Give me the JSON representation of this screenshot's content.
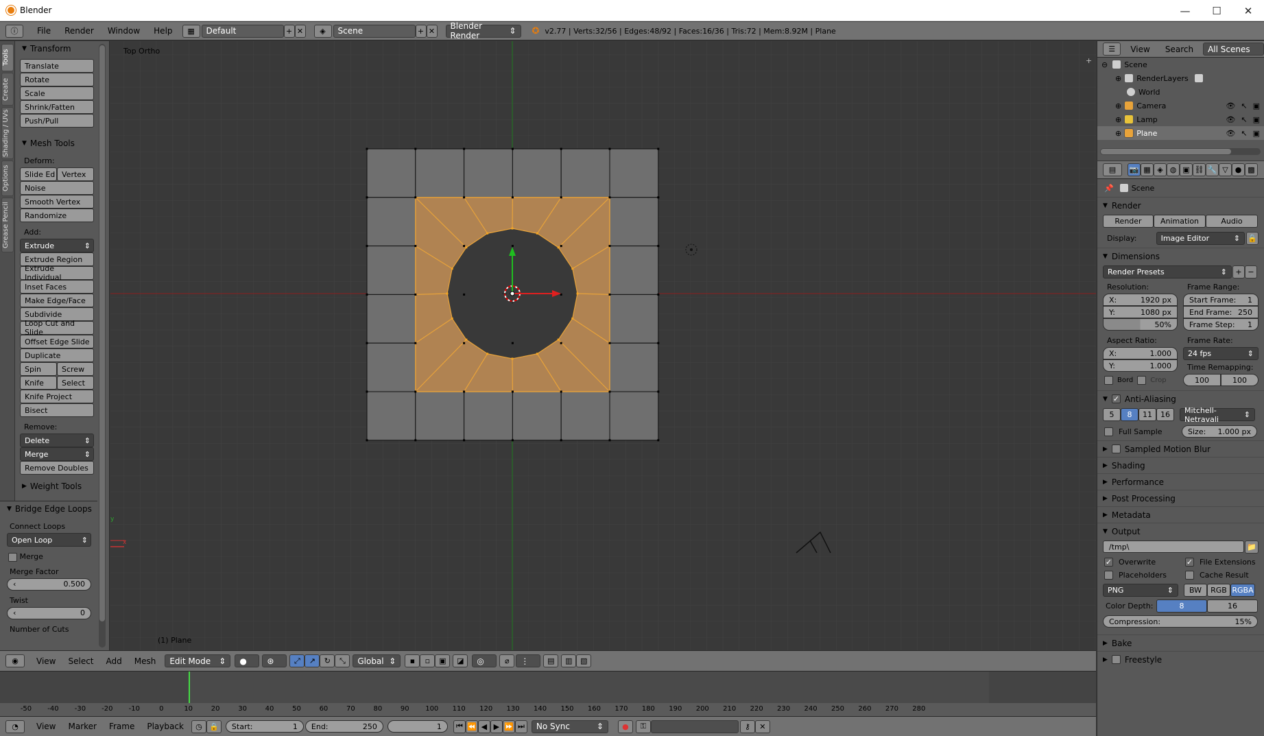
{
  "window": {
    "title": "Blender",
    "minimize": "—",
    "maximize": "☐",
    "close": "✕"
  },
  "info": {
    "menus": [
      "File",
      "Render",
      "Window",
      "Help"
    ],
    "layout": "Default",
    "scene": "Scene",
    "engine": "Blender Render",
    "stats": "v2.77 | Verts:32/56 | Edges:48/92 | Faces:16/36 | Tris:72 | Mem:8.92M | Plane"
  },
  "tabs": [
    "Tools",
    "Create",
    "Shading / UVs",
    "Options",
    "Grease Pencil"
  ],
  "tools": {
    "transform_title": "Transform",
    "transform": [
      "Translate",
      "Rotate",
      "Scale",
      "Shrink/Fatten",
      "Push/Pull"
    ],
    "mesh_title": "Mesh Tools",
    "deform_label": "Deform:",
    "deform_row": [
      "Slide Ed",
      "Vertex"
    ],
    "deform": [
      "Noise",
      "Smooth Vertex",
      "Randomize"
    ],
    "add_label": "Add:",
    "extrude": "Extrude",
    "add": [
      "Extrude Region",
      "Extrude Individual",
      "Inset Faces",
      "Make Edge/Face",
      "Subdivide",
      "Loop Cut and Slide",
      "Offset Edge Slide",
      "Duplicate"
    ],
    "spin_row": [
      "Spin",
      "Screw"
    ],
    "knife_row": [
      "Knife",
      "Select"
    ],
    "add2": [
      "Knife Project",
      "Bisect"
    ],
    "remove_label": "Remove:",
    "delete": "Delete",
    "merge": "Merge",
    "remove_doubles": "Remove Doubles",
    "weight_title": "Weight Tools"
  },
  "redo": {
    "title": "Bridge Edge Loops",
    "connect_label": "Connect Loops",
    "connect_value": "Open Loop",
    "merge_label": "Merge",
    "merge_factor_label": "Merge Factor",
    "merge_factor": "0.500",
    "twist_label": "Twist",
    "twist": "0",
    "cuts_label": "Number of Cuts"
  },
  "viewport": {
    "view_name": "Top Ortho",
    "object_label": "(1) Plane",
    "axis_y": "y",
    "axis_x": "x"
  },
  "vphead": {
    "menus": [
      "View",
      "Select",
      "Add",
      "Mesh"
    ],
    "mode": "Edit Mode",
    "orientation": "Global"
  },
  "timeline": {
    "ticks": [
      "-50",
      "-40",
      "-30",
      "-20",
      "-10",
      "0",
      "10",
      "20",
      "30",
      "40",
      "50",
      "60",
      "70",
      "80",
      "90",
      "100",
      "110",
      "120",
      "130",
      "140",
      "150",
      "160",
      "170",
      "180",
      "190",
      "200",
      "210",
      "220",
      "230",
      "240",
      "250",
      "260",
      "270",
      "280"
    ],
    "menus": [
      "View",
      "Marker",
      "Frame",
      "Playback"
    ],
    "start_label": "Start:",
    "start": "1",
    "end_label": "End:",
    "end": "250",
    "current": "1",
    "sync": "No Sync"
  },
  "outliner": {
    "menus": [
      "View",
      "Search"
    ],
    "filter": "All Scenes",
    "items": [
      "Scene",
      "RenderLayers",
      "World",
      "Camera",
      "Lamp",
      "Plane"
    ]
  },
  "props": {
    "context": "Scene",
    "render_title": "Render",
    "render_btns": [
      "Render",
      "Animation",
      "Audio"
    ],
    "display_label": "Display:",
    "display_value": "Image Editor",
    "dimensions_title": "Dimensions",
    "presets": "Render Presets",
    "resolution_label": "Resolution:",
    "res_x_label": "X:",
    "res_x": "1920 px",
    "res_y_label": "Y:",
    "res_y": "1080 px",
    "res_pct": "50%",
    "frame_range_label": "Frame Range:",
    "start_frame_label": "Start Frame:",
    "start_frame": "1",
    "end_frame_label": "End Frame:",
    "end_frame": "250",
    "frame_step_label": "Frame Step:",
    "frame_step": "1",
    "aspect_label": "Aspect Ratio:",
    "aspect_x_label": "X:",
    "aspect_x": "1.000",
    "aspect_y_label": "Y:",
    "aspect_y": "1.000",
    "frame_rate_label": "Frame Rate:",
    "frame_rate": "24 fps",
    "time_remap_label": "Time Remapping:",
    "remap_old": "100",
    "remap_new": "100",
    "bord": "Bord",
    "crop": "Crop",
    "aa_title": "Anti-Aliasing",
    "aa_samples": [
      "5",
      "8",
      "11",
      "16"
    ],
    "aa_filter": "Mitchell-Netravali",
    "full_sample": "Full Sample",
    "size_label": "Size:",
    "size": "1.000 px",
    "motion_blur": "Sampled Motion Blur",
    "shading": "Shading",
    "performance": "Performance",
    "post": "Post Processing",
    "metadata": "Metadata",
    "output_title": "Output",
    "path": "/tmp\\",
    "overwrite": "Overwrite",
    "file_ext": "File Extensions",
    "placeholders": "Placeholders",
    "cache": "Cache Result",
    "format": "PNG",
    "color_modes": [
      "BW",
      "RGB",
      "RGBA"
    ],
    "depth_label": "Color Depth:",
    "depths": [
      "8",
      "16"
    ],
    "compression_label": "Compression:",
    "compression": "15%",
    "bake": "Bake",
    "freestyle": "Freestyle"
  },
  "colors": {
    "selected_face": "#b08352",
    "edge_orange": "#e8a33a",
    "face_gray": "#6f6f6f",
    "x_axis": "#b30000",
    "y_axis": "#1e9b1e"
  }
}
